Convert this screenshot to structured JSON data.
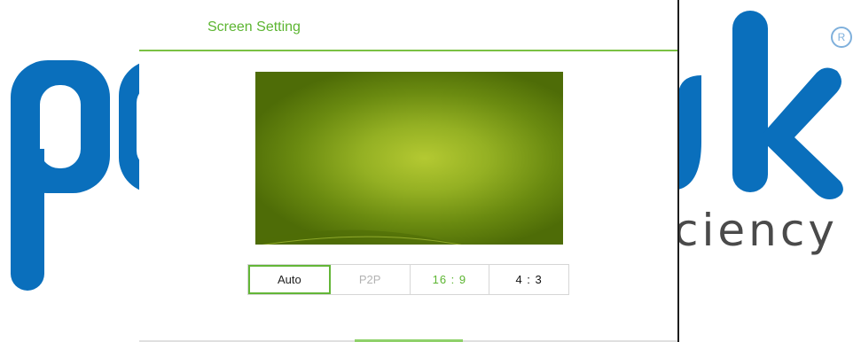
{
  "dialog": {
    "title": "Screen Setting",
    "aspect_options": [
      {
        "label": "Auto",
        "state": "selected"
      },
      {
        "label": "P2P",
        "state": "disabled"
      },
      {
        "label": "16 : 9",
        "state": "normal"
      },
      {
        "label": "4 : 3",
        "state": "normal"
      }
    ]
  },
  "background_logo": {
    "tagline_fragment": "ciency",
    "registered_mark": "R"
  },
  "colors": {
    "accent_green": "#5cb531",
    "title_line": "#7ac143",
    "logo_blue": "#0a6fbc"
  }
}
